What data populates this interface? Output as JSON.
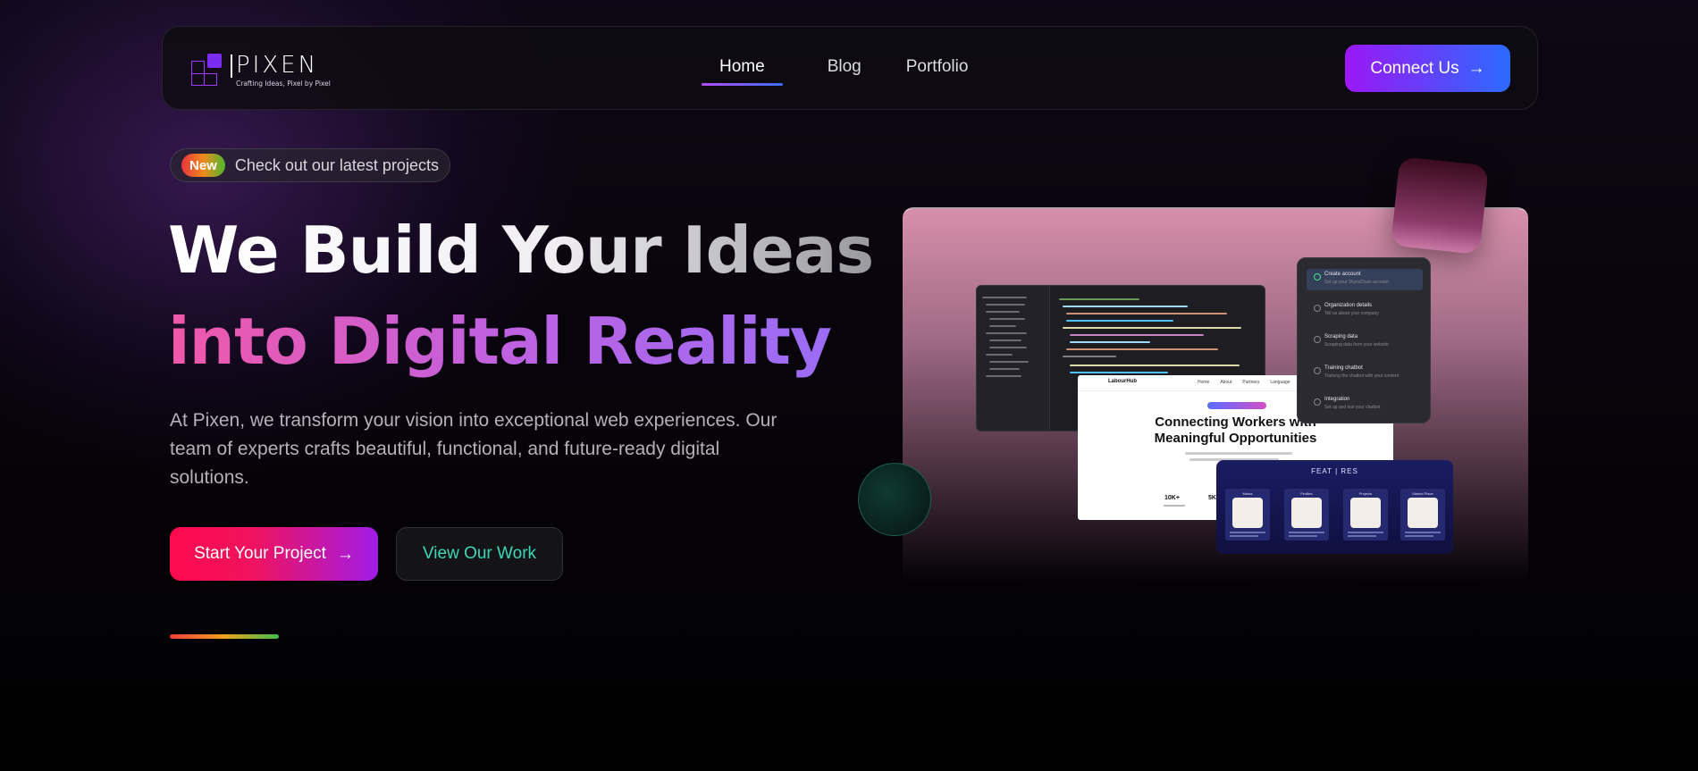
{
  "brand": {
    "name": "PIXEN",
    "tagline": "Crafting Ideas, Pixel by Pixel"
  },
  "nav": {
    "links": [
      {
        "label": "Home",
        "active": true
      },
      {
        "label": "Blog",
        "active": false
      },
      {
        "label": "Portfolio",
        "active": false
      }
    ],
    "cta_label": "Connect Us",
    "cta_icon": "arrow-right-icon"
  },
  "hero": {
    "badge_label": "New",
    "badge_text": "Check out our latest projects",
    "headline_line1": "We Build Your Ideas",
    "headline_line2": "into Digital Reality",
    "description": "At Pixen, we transform your vision into exceptional web experiences. Our team of experts crafts beautiful, functional, and future-ready digital solutions.",
    "primary_button": "Start Your Project",
    "secondary_button": "View Our Work"
  },
  "showcase": {
    "site_logo": "LabourHub",
    "site_links": [
      "Home",
      "About",
      "Partners",
      "Language"
    ],
    "site_title_line1": "Connecting Workers with",
    "site_title_line2": "Meaningful Opportunities",
    "site_stat_1": "10K+",
    "site_stat_2": "5K",
    "steps": [
      {
        "title": "Create account",
        "desc": "Set up your SkyraChain account"
      },
      {
        "title": "Organization details",
        "desc": "Tell us about your company"
      },
      {
        "title": "Scraping data",
        "desc": "Scraping data from your website"
      },
      {
        "title": "Training chatbot",
        "desc": "Training the chatbot with your content"
      },
      {
        "title": "Integration",
        "desc": "Set up and test your chatbot"
      }
    ],
    "features_title": "FEAT | RES",
    "feature_labels": [
      "Metas",
      "Profiles",
      "Projects",
      "Market Place"
    ]
  },
  "colors": {
    "background": "#050307",
    "accent_purple": "#9b17f5",
    "accent_blue": "#2b6bff",
    "primary_pink": "#ff0a4e",
    "teal_text": "#3fd6b8"
  }
}
